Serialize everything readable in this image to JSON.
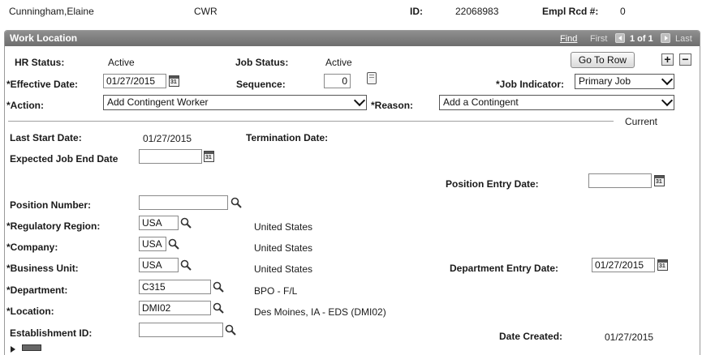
{
  "header": {
    "employee_name": "Cunningham,Elaine",
    "employee_type": "CWR",
    "id_label": "ID:",
    "id_value": "22068983",
    "empl_rcd_label": "Empl Rcd #:",
    "empl_rcd_value": "0"
  },
  "panel": {
    "title": "Work Location",
    "find": "Find",
    "first": "First",
    "count": "1 of 1",
    "last": "Last"
  },
  "form": {
    "hr_status_label": "HR Status:",
    "hr_status_value": "Active",
    "job_status_label": "Job Status:",
    "job_status_value": "Active",
    "go_to_row": "Go To Row",
    "add_row": "+",
    "delete_row": "−",
    "effective_date_label": "*Effective Date:",
    "effective_date_value": "01/27/2015",
    "sequence_label": "Sequence:",
    "sequence_value": "0",
    "job_indicator_label": "*Job Indicator:",
    "job_indicator_value": "Primary Job",
    "action_label": "*Action:",
    "action_value": "Add Contingent Worker",
    "reason_label": "*Reason:",
    "reason_value": "Add a Contingent",
    "current_label": "Current",
    "last_start_label": "Last Start Date:",
    "last_start_value": "01/27/2015",
    "termination_label": "Termination Date:",
    "expected_end_label": "Expected Job End Date",
    "expected_end_value": "",
    "position_entry_label": "Position Entry Date:",
    "position_entry_value": "",
    "position_number_label": "Position Number:",
    "position_number_value": "",
    "regulatory_region_label": "*Regulatory Region:",
    "regulatory_region_value": "USA",
    "regulatory_region_desc": "United States",
    "company_label": "*Company:",
    "company_value": "USA",
    "company_desc": "United States",
    "business_unit_label": "*Business Unit:",
    "business_unit_value": "USA",
    "business_unit_desc": "United States",
    "department_entry_label": "Department Entry Date:",
    "department_entry_value": "01/27/2015",
    "department_label": "*Department:",
    "department_value": "C315",
    "department_desc": "BPO - F/L",
    "location_label": "*Location:",
    "location_value": "DMI02",
    "location_desc": "Des Moines, IA - EDS (DMI02)",
    "establishment_label": "Establishment ID:",
    "establishment_value": "",
    "date_created_label": "Date Created:",
    "date_created_value": "01/27/2015"
  },
  "icons": {
    "calendar": "calendar-icon",
    "lookup": "magnifier-icon"
  }
}
